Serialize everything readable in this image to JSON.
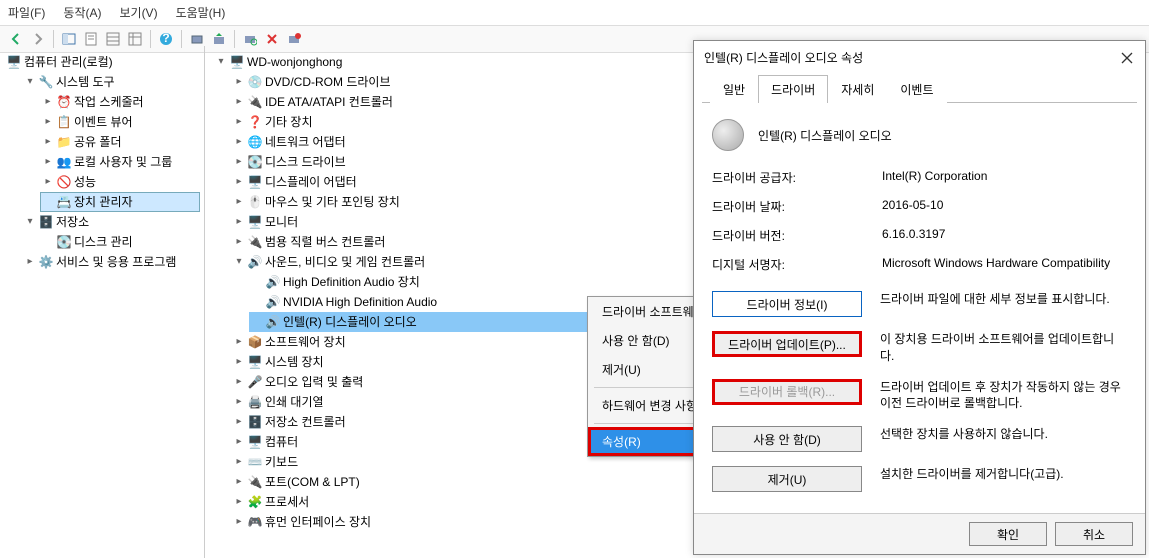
{
  "menubar": {
    "file": "파일(F)",
    "actions": "동작(A)",
    "view": "보기(V)",
    "help": "도움말(H)"
  },
  "left_tree": {
    "root": "컴퓨터 관리(로컬)",
    "sys_tools": "시스템 도구",
    "task_sched": "작업 스케줄러",
    "event_viewer": "이벤트 뷰어",
    "shared_folders": "공유 폴더",
    "local_users": "로컬 사용자 및 그룹",
    "performance": "성능",
    "device_manager": "장치 관리자",
    "storage": "저장소",
    "disk_mgmt": "디스크 관리",
    "services": "서비스 및 응용 프로그램"
  },
  "dev_tree": {
    "root": "WD-wonjonghong",
    "dvd": "DVD/CD-ROM 드라이브",
    "ide": "IDE ATA/ATAPI 컨트롤러",
    "other": "기타 장치",
    "net": "네트워크 어댑터",
    "disk": "디스크 드라이브",
    "display": "디스플레이 어댑터",
    "mouse": "마우스 및 기타 포인팅 장치",
    "monitor": "모니터",
    "usb": "범용 직렬 버스 컨트롤러",
    "sound": "사운드, 비디오 및 게임 컨트롤러",
    "snd_hd": "High Definition Audio 장치",
    "snd_nvidia": "NVIDIA High Definition Audio",
    "snd_intel": "인텔(R) 디스플레이 오디오",
    "software": "소프트웨어 장치",
    "system": "시스템 장치",
    "audio_io": "오디오 입력 및 출력",
    "printq": "인쇄 대기열",
    "storage_ctrl": "저장소 컨트롤러",
    "computer": "컴퓨터",
    "keyboard": "키보드",
    "ports": "포트(COM & LPT)",
    "processor": "프로세서",
    "hid": "휴먼 인터페이스 장치"
  },
  "ctx": {
    "update": "드라이버 소프트웨어 업데이트(P)...",
    "disable": "사용 안 함(D)",
    "uninstall": "제거(U)",
    "scan": "하드웨어 변경 사항 검색(A)",
    "properties": "속성(R)"
  },
  "dlg": {
    "title": "인텔(R) 디스플레이 오디오 속성",
    "tab_general": "일반",
    "tab_driver": "드라이버",
    "tab_details": "자세히",
    "tab_events": "이벤트",
    "device_name": "인텔(R) 디스플레이 오디오",
    "provider_label": "드라이버 공급자:",
    "provider_value": "Intel(R) Corporation",
    "date_label": "드라이버 날짜:",
    "date_value": "2016-05-10",
    "version_label": "드라이버 버전:",
    "version_value": "6.16.0.3197",
    "signer_label": "디지털 서명자:",
    "signer_value": "Microsoft Windows Hardware Compatibility",
    "btn_info": "드라이버 정보(I)",
    "btn_info_desc": "드라이버 파일에 대한 세부 정보를 표시합니다.",
    "btn_update": "드라이버 업데이트(P)...",
    "btn_update_desc": "이 장치용 드라이버 소프트웨어를 업데이트합니다.",
    "btn_rollback": "드라이버 롤백(R)...",
    "btn_rollback_desc": "드라이버 업데이트 후 장치가 작동하지 않는 경우 이전 드라이버로 롤백합니다.",
    "btn_disable": "사용 안 함(D)",
    "btn_disable_desc": "선택한 장치를 사용하지 않습니다.",
    "btn_uninstall": "제거(U)",
    "btn_uninstall_desc": "설치한 드라이버를 제거합니다(고급).",
    "ok": "확인",
    "cancel": "취소"
  }
}
